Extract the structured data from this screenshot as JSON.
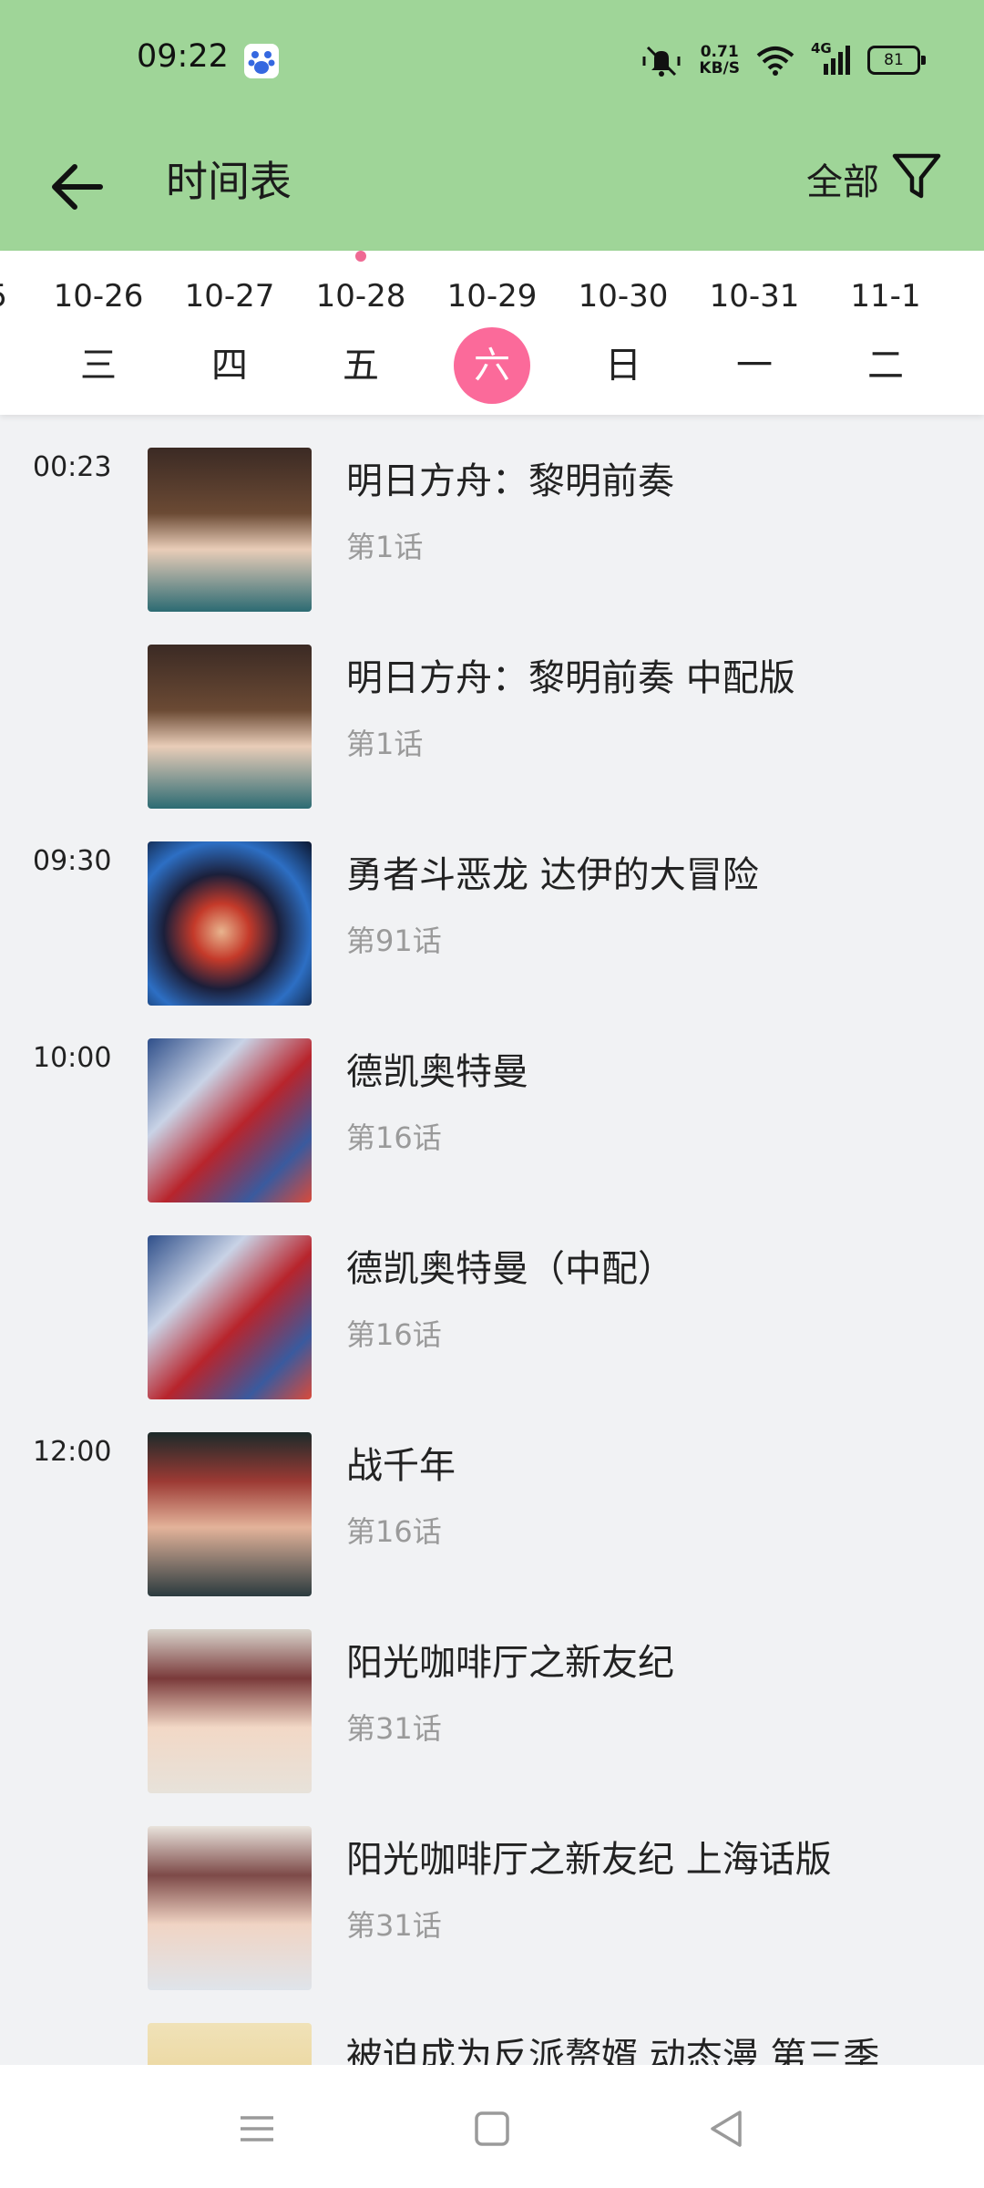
{
  "status": {
    "time": "09:22",
    "speed_value": "0.71",
    "speed_unit": "KB/S",
    "network": "4G",
    "battery": "81"
  },
  "header": {
    "title": "时间表",
    "filter_label": "全部"
  },
  "dates": [
    {
      "date": "5",
      "weekday": ""
    },
    {
      "date": "10-26",
      "weekday": "三"
    },
    {
      "date": "10-27",
      "weekday": "四"
    },
    {
      "date": "10-28",
      "weekday": "五"
    },
    {
      "date": "10-29",
      "weekday": "六"
    },
    {
      "date": "10-30",
      "weekday": "日"
    },
    {
      "date": "10-31",
      "weekday": "一"
    },
    {
      "date": "11-1",
      "weekday": "二"
    }
  ],
  "today_date": "10-28",
  "selected_date": "10-29",
  "accent_color": "#fb6a9a",
  "header_color": "#9fd598",
  "schedule": [
    {
      "time": "00:23",
      "title": "明日方舟：黎明前奏",
      "episode": "第1话"
    },
    {
      "time": "",
      "title": "明日方舟：黎明前奏 中配版",
      "episode": "第1话"
    },
    {
      "time": "09:30",
      "title": "勇者斗恶龙 达伊的大冒险",
      "episode": "第91话"
    },
    {
      "time": "10:00",
      "title": "德凯奥特曼",
      "episode": "第16话"
    },
    {
      "time": "",
      "title": "德凯奥特曼（中配）",
      "episode": "第16话"
    },
    {
      "time": "12:00",
      "title": "战千年",
      "episode": "第16话"
    },
    {
      "time": "",
      "title": "阳光咖啡厅之新友纪",
      "episode": "第31话"
    },
    {
      "time": "",
      "title": "阳光咖啡厅之新友纪 上海话版",
      "episode": "第31话"
    },
    {
      "time": "",
      "title": "被迫成为反派赘婿 动态漫 第三季",
      "episode": ""
    }
  ]
}
